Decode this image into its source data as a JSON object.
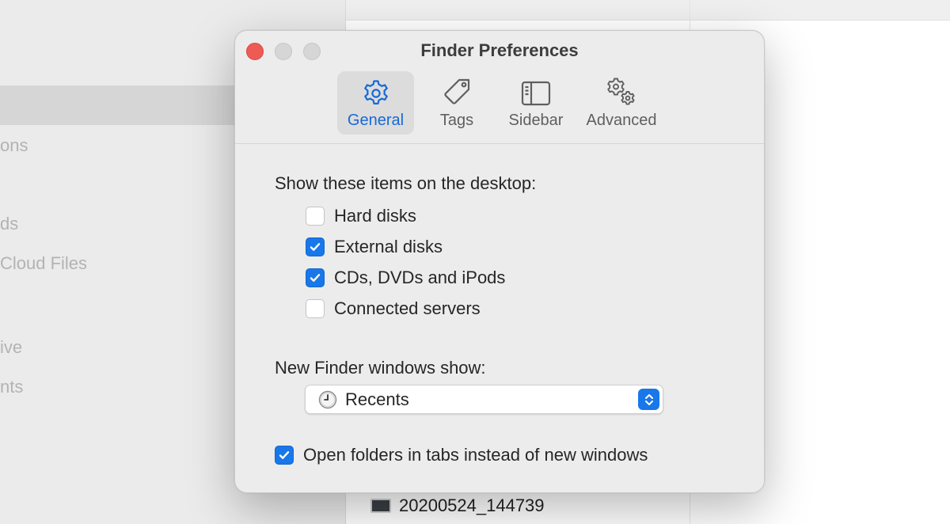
{
  "background": {
    "sidebar_fragments": [
      "ons",
      "ds",
      "Cloud Files",
      "ive",
      "nts"
    ],
    "file_row": {
      "name": "20200524_144739"
    }
  },
  "dialog": {
    "title": "Finder Preferences",
    "tabs": [
      {
        "label": "General",
        "icon": "gear-icon",
        "active": true
      },
      {
        "label": "Tags",
        "icon": "tag-icon",
        "active": false
      },
      {
        "label": "Sidebar",
        "icon": "sidebar-icon",
        "active": false
      },
      {
        "label": "Advanced",
        "icon": "gears-icon",
        "active": false
      }
    ],
    "desktop_section": {
      "label": "Show these items on the desktop:",
      "items": [
        {
          "label": "Hard disks",
          "checked": false
        },
        {
          "label": "External disks",
          "checked": true
        },
        {
          "label": "CDs, DVDs and iPods",
          "checked": true
        },
        {
          "label": "Connected servers",
          "checked": false
        }
      ]
    },
    "new_window_section": {
      "label": "New Finder windows show:",
      "selected_value": "Recents"
    },
    "tabs_option": {
      "label": "Open folders in tabs instead of new windows",
      "checked": true
    }
  },
  "colors": {
    "accent": "#1877e9",
    "close": "#ee5b55",
    "active_tab_text": "#1769d6"
  }
}
